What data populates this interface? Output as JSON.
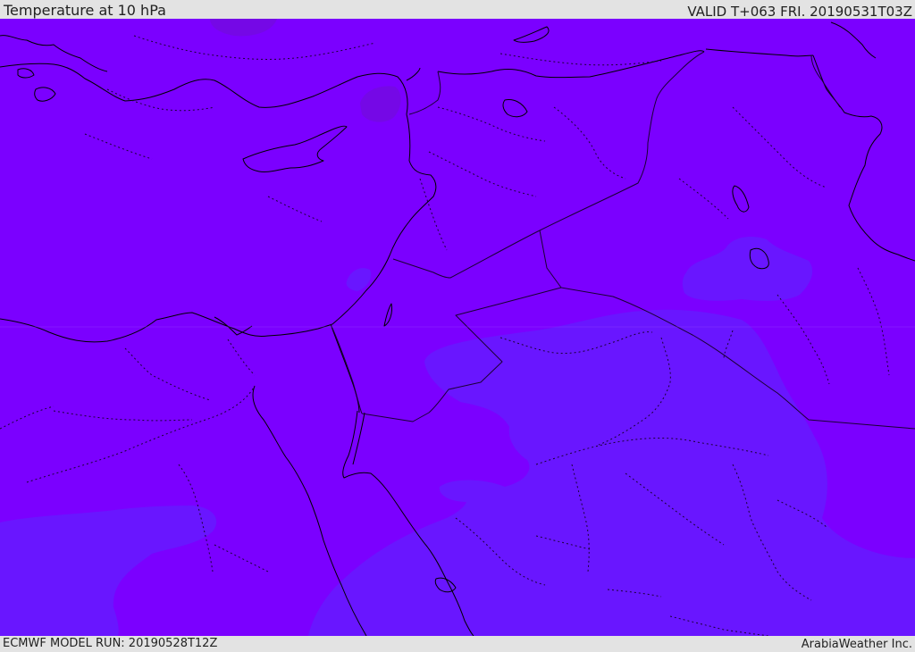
{
  "header": {
    "title": "Temperature at 10 hPa",
    "valid_time": "VALID T+063 FRI. 20190531T03Z"
  },
  "footer": {
    "model_run": "ECMWF MODEL RUN: 20190528T12Z",
    "credit": "ArabiaWeather Inc."
  },
  "map": {
    "field": "Temperature",
    "level": "10 hPa",
    "colors": {
      "warm_fill": "#7b00ff",
      "cool_fill": "#6916ff",
      "warm_patch": "#7508e6",
      "coastline": "#000000",
      "border": "#1a0033"
    }
  }
}
